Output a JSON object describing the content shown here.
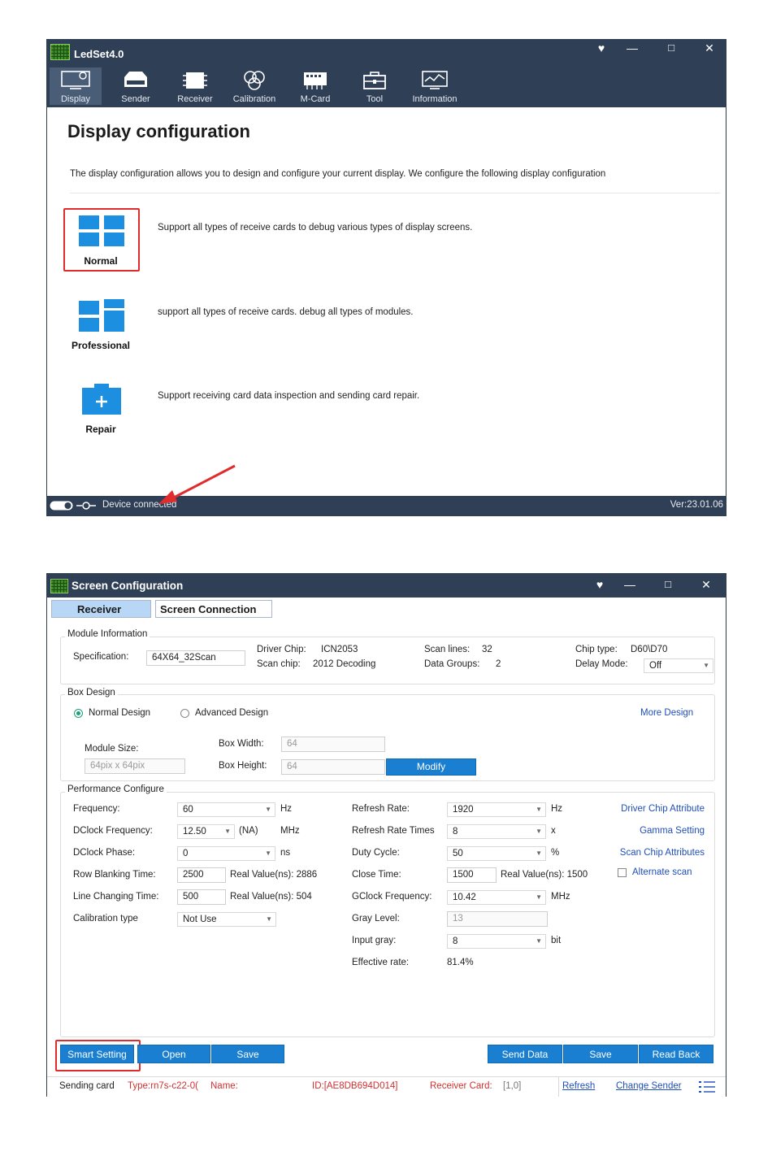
{
  "window1": {
    "app_title": "LedSet4.0",
    "nav": [
      {
        "label": "Display",
        "icon": "monitor-gear-icon"
      },
      {
        "label": "Sender",
        "icon": "sender-box-icon"
      },
      {
        "label": "Receiver",
        "icon": "chip-icon"
      },
      {
        "label": "Calibration",
        "icon": "rgb-circles-icon"
      },
      {
        "label": "M-Card",
        "icon": "mcard-icon"
      },
      {
        "label": "Tool",
        "icon": "toolbox-icon"
      },
      {
        "label": "Information",
        "icon": "chart-monitor-icon"
      }
    ],
    "heading": "Display configuration",
    "description": "The display configuration allows you to design and configure your current display. We configure the following display configuration",
    "modes": [
      {
        "name": "Normal",
        "description": "Support all types of receive cards to debug various types of display screens."
      },
      {
        "name": "Professional",
        "description": "support all types of receive cards. debug all types of modules."
      },
      {
        "name": "Repair",
        "description": "Support receiving card data inspection and sending card repair."
      }
    ],
    "status_text": "Device connected",
    "version": "Ver:23.01.06",
    "accent_color": "#2f3f56",
    "tile_color": "#1c8fe0",
    "highlight_color": "#e02c2c"
  },
  "window2": {
    "app_title": "Screen Configuration",
    "tabs": [
      "Receiver",
      "Screen Connection"
    ],
    "module_info": {
      "title": "Module Information",
      "spec_label": "Specification:",
      "spec_value": "64X64_32Scan",
      "driver_chip_label": "Driver Chip:",
      "driver_chip_value": "ICN2053",
      "scan_chip_label": "Scan chip:",
      "scan_chip_value": "2012 Decoding",
      "scan_lines_label": "Scan lines:",
      "scan_lines_value": "32",
      "data_groups_label": "Data Groups:",
      "data_groups_value": "2",
      "chip_type_label": "Chip type:",
      "chip_type_value": "D60\\D70",
      "delay_mode_label": "Delay Mode:",
      "delay_mode_value": "Off"
    },
    "box_design": {
      "title": "Box Design",
      "normal_label": "Normal Design",
      "advanced_label": "Advanced Design",
      "more_link": "More Design",
      "module_size_label": "Module Size:",
      "module_size_value": "64pix x 64pix",
      "box_width_label": "Box Width:",
      "box_width_value": "64",
      "box_height_label": "Box Height:",
      "box_height_value": "64",
      "modify_button": "Modify"
    },
    "performance": {
      "title": "Performance Configure",
      "frequency_label": "Frequency:",
      "frequency_value": "60",
      "frequency_unit": "Hz",
      "dclock_freq_label": "DClock Frequency:",
      "dclock_freq_value": "12.50",
      "dclock_na": "(NA)",
      "dclock_unit": "MHz",
      "dclock_phase_label": "DClock Phase:",
      "dclock_phase_value": "0",
      "dclock_phase_unit": "ns",
      "row_blanking_label": "Row Blanking Time:",
      "row_blanking_value": "2500",
      "row_blanking_real": "Real Value(ns): 2886",
      "line_changing_label": "Line Changing Time:",
      "line_changing_value": "500",
      "line_changing_real": "Real Value(ns): 504",
      "calibration_label": "Calibration type",
      "calibration_value": "Not Use",
      "refresh_rate_label": "Refresh Rate:",
      "refresh_rate_value": "1920",
      "refresh_rate_unit": "Hz",
      "refresh_times_label": "Refresh Rate Times",
      "refresh_times_value": "8",
      "refresh_times_unit": "x",
      "duty_cycle_label": "Duty Cycle:",
      "duty_cycle_value": "50",
      "duty_cycle_unit": "%",
      "close_time_label": "Close Time:",
      "close_time_value": "1500",
      "close_time_real": "Real Value(ns): 1500",
      "gclock_label": "GClock Frequency:",
      "gclock_value": "10.42",
      "gclock_unit": "MHz",
      "gray_level_label": "Gray Level:",
      "gray_level_value": "13",
      "input_gray_label": "Input gray:",
      "input_gray_value": "8",
      "input_gray_unit": "bit",
      "effective_rate_label": "Effective rate:",
      "effective_rate_value": "81.4%",
      "links": [
        "Driver Chip Attribute",
        "Gamma Setting",
        "Scan Chip Attributes"
      ],
      "alternate_scan_label": "Alternate scan"
    },
    "buttons": {
      "smart_setting": "Smart Setting",
      "open": "Open",
      "save_left": "Save",
      "send_data": "Send Data",
      "save_right": "Save",
      "read_back": "Read Back"
    },
    "status": {
      "sending_card": "Sending card",
      "type": "Type:rn7s-c22-0(",
      "name": "Name:",
      "id": "ID:[AE8DB694D014]",
      "receiver_card_label": "Receiver Card:",
      "receiver_card_value": "[1,0]",
      "refresh_link": "Refresh",
      "change_sender_link": "Change Sender"
    }
  }
}
